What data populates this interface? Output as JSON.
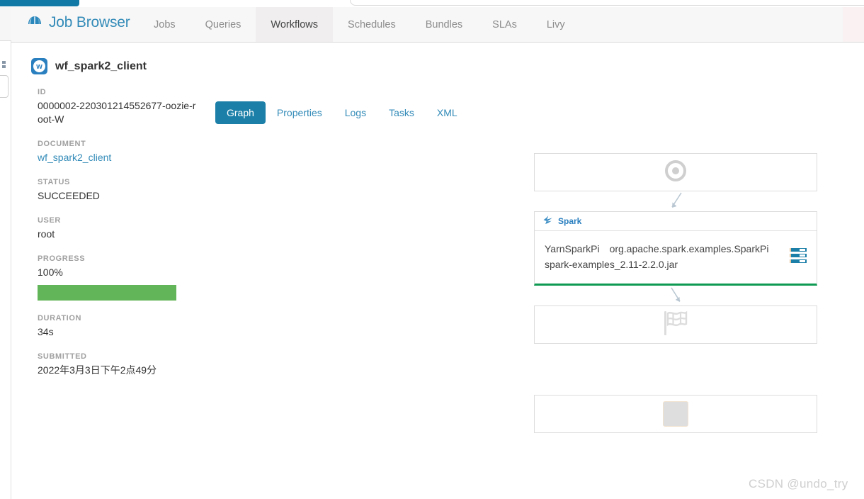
{
  "browser": {
    "tab_fragment": "",
    "urlbar_value": ""
  },
  "navbar": {
    "brand": "Job Browser",
    "brand_icon": "hue-logo-icon",
    "tabs": [
      {
        "label": "Jobs",
        "active": false
      },
      {
        "label": "Queries",
        "active": false
      },
      {
        "label": "Workflows",
        "active": true
      },
      {
        "label": "Schedules",
        "active": false
      },
      {
        "label": "Bundles",
        "active": false
      },
      {
        "label": "SLAs",
        "active": false
      },
      {
        "label": "Livy",
        "active": false
      }
    ]
  },
  "workflow": {
    "badge_letter": "w",
    "name": "wf_spark2_client"
  },
  "details": [
    {
      "label": "ID",
      "value": "0000002-220301214552677-oozie-root-W",
      "link": false
    },
    {
      "label": "DOCUMENT",
      "value": "wf_spark2_client",
      "link": true
    },
    {
      "label": "STATUS",
      "value": "SUCCEEDED",
      "link": false
    },
    {
      "label": "USER",
      "value": "root",
      "link": false
    },
    {
      "label": "PROGRESS",
      "value": "100%",
      "link": false,
      "progress": 100
    },
    {
      "label": "DURATION",
      "value": "34s",
      "link": false
    },
    {
      "label": "SUBMITTED",
      "value": "2022年3月3日下午2点49分",
      "link": false
    }
  ],
  "content_tabs": [
    {
      "label": "Graph",
      "active": true
    },
    {
      "label": "Properties",
      "active": false
    },
    {
      "label": "Logs",
      "active": false
    },
    {
      "label": "Tasks",
      "active": false
    },
    {
      "label": "XML",
      "active": false
    }
  ],
  "graph": {
    "start_node": {
      "icon": "start-target-icon"
    },
    "action_node": {
      "type_label": "Spark",
      "type_icon": "spark-logo-icon",
      "name": "YarnSparkPi",
      "main_class": "org.apache.spark.examples.SparkPi",
      "jar": "spark-examples_2.11-2.2.0.jar",
      "logs_icon": "logs-list-icon",
      "status_color": "#0e9a52"
    },
    "end_node": {
      "icon": "checkered-flag-icon"
    },
    "kill_node": {
      "icon": "kill-square-icon"
    }
  },
  "watermark": "CSDN @undo_try",
  "colors": {
    "brand_blue": "#338bb8",
    "active_tab_blue": "#1b7fa8",
    "success_green": "#62b558",
    "node_green": "#0e9a52"
  }
}
